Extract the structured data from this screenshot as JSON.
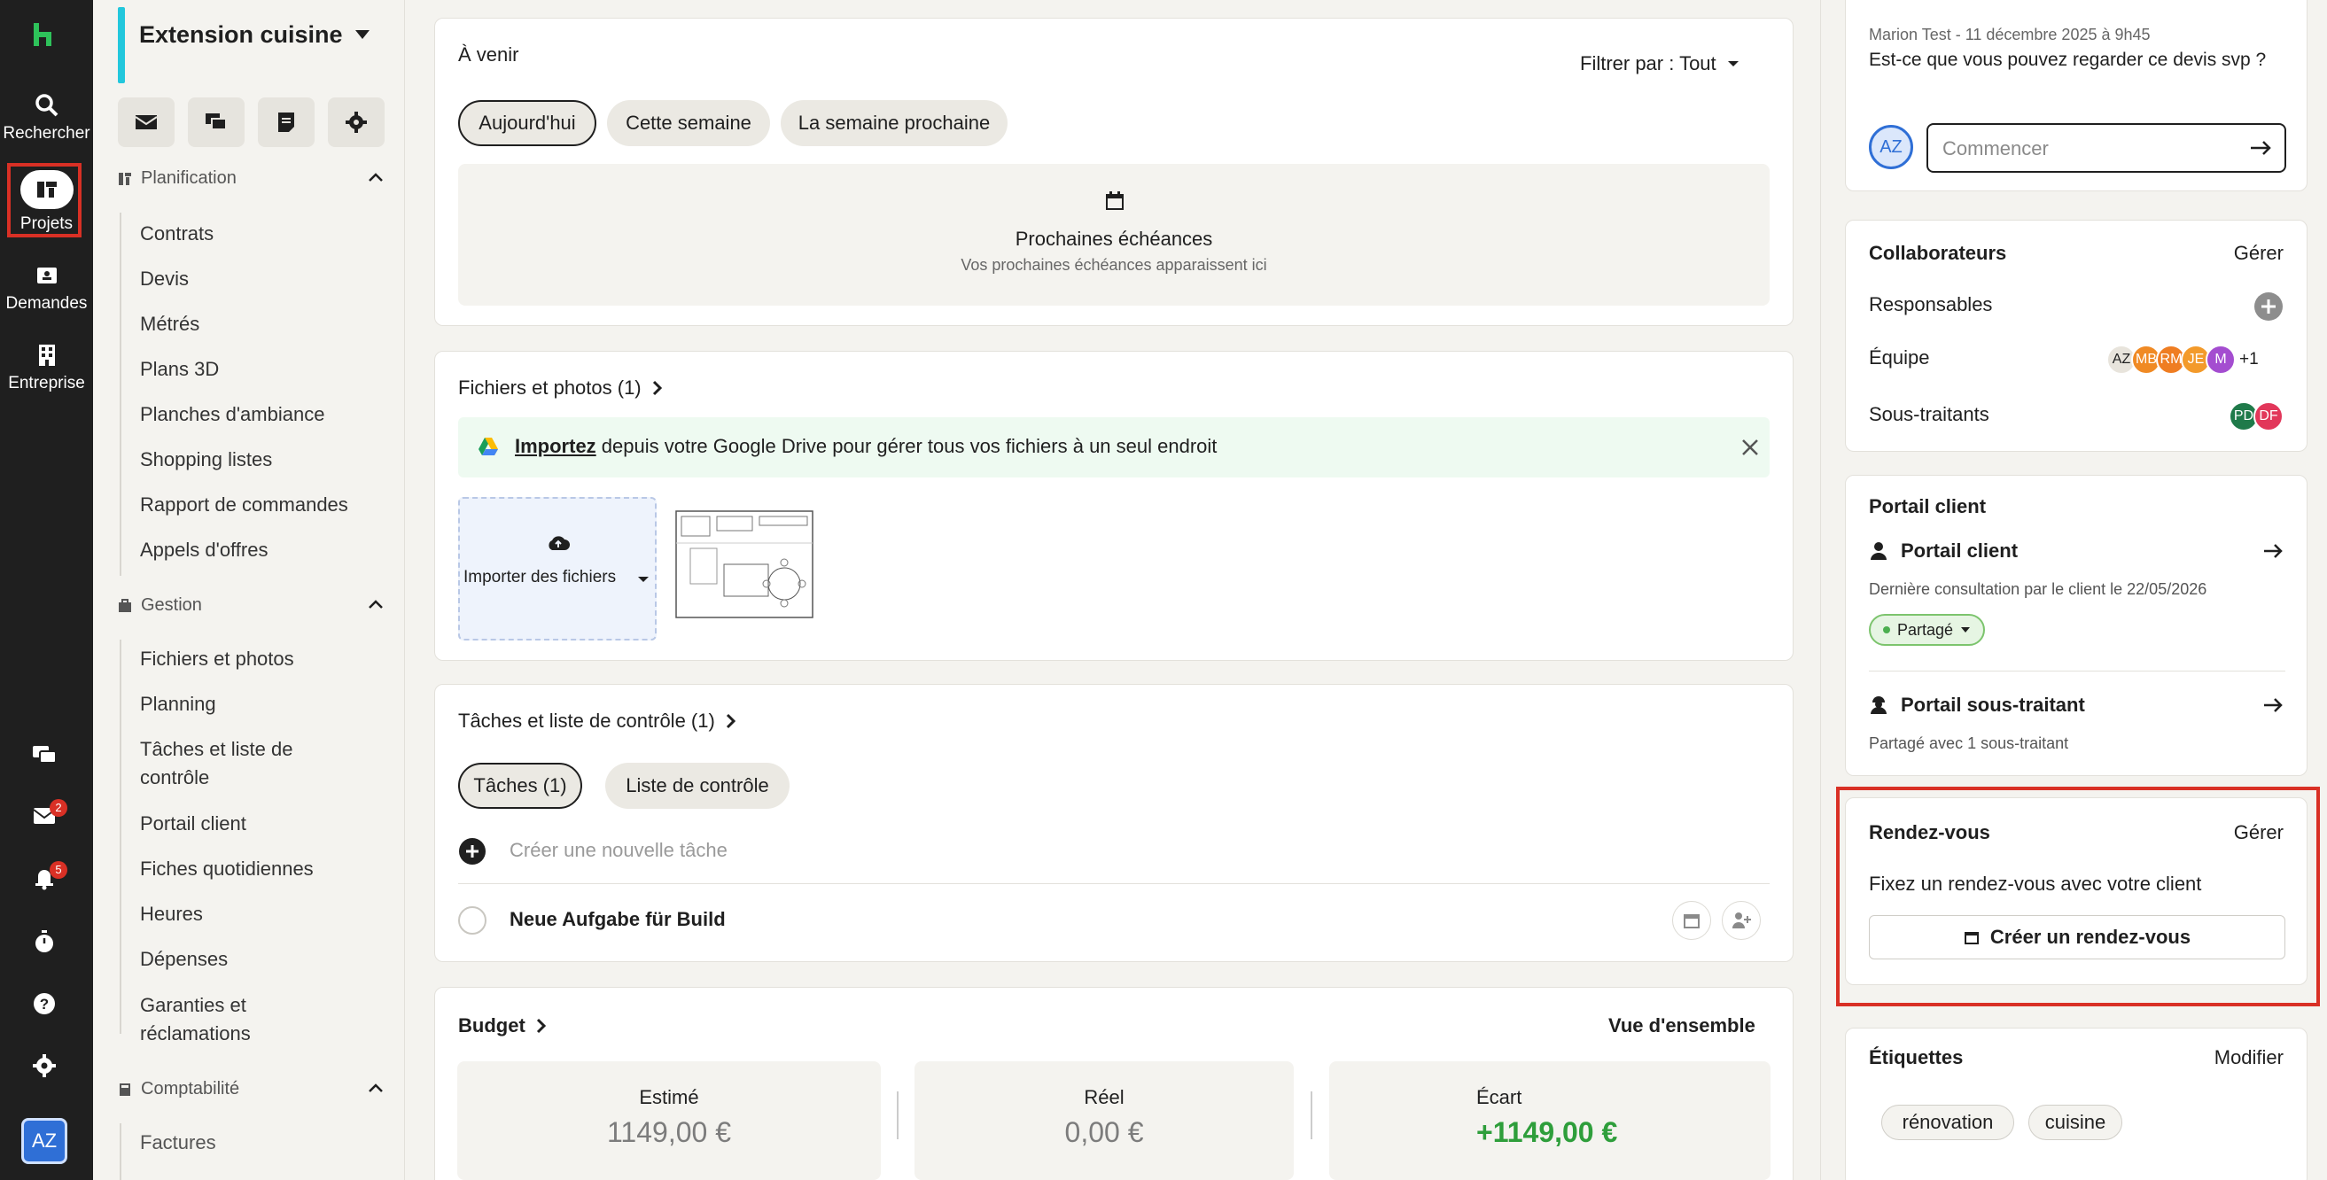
{
  "rail": {
    "items": [
      {
        "label": "Rechercher",
        "icon": "search-icon"
      },
      {
        "label": "Projets",
        "icon": "projects-icon"
      },
      {
        "label": "Demandes",
        "icon": "requests-icon"
      },
      {
        "label": "Entreprise",
        "icon": "building-icon"
      }
    ],
    "badges": {
      "inbox": "2",
      "notifications": "5"
    },
    "avatar": "AZ"
  },
  "project": {
    "name": "Extension cuisine",
    "sections": [
      {
        "title": "Planification",
        "items": [
          "Contrats",
          "Devis",
          "Métrés",
          "Plans 3D",
          "Planches d'ambiance",
          "Shopping listes",
          "Rapport de commandes",
          "Appels d'offres"
        ]
      },
      {
        "title": "Gestion",
        "items": [
          "Fichiers et photos",
          "Planning",
          "Tâches et liste de contrôle",
          "Portail client",
          "Fiches quotidiennes",
          "Heures",
          "Dépenses",
          "Garanties et réclamations"
        ]
      },
      {
        "title": "Comptabilité",
        "items": [
          "Factures"
        ]
      }
    ]
  },
  "upcoming": {
    "title": "À venir",
    "filter": "Filtrer par : Tout",
    "pills": [
      "Aujourd'hui",
      "Cette semaine",
      "La semaine prochaine"
    ],
    "empty_title": "Prochaines échéances",
    "empty_sub": "Vos prochaines échéances apparaissent ici"
  },
  "files": {
    "title": "Fichiers et photos (1)",
    "banner_link": "Importez",
    "banner_text": " depuis votre Google Drive pour gérer tous vos fichiers à un seul endroit",
    "upload_label": "Importer des fichiers"
  },
  "tasks": {
    "title": "Tâches et liste de contrôle (1)",
    "pills": [
      "Tâches (1)",
      "Liste de contrôle"
    ],
    "new_placeholder": "Créer une nouvelle tâche",
    "items": [
      "Neue Aufgabe für Build"
    ]
  },
  "budget": {
    "title": "Budget",
    "overview": "Vue d'ensemble",
    "boxes": [
      {
        "label": "Estimé",
        "value": "1149,00 €"
      },
      {
        "label": "Réel",
        "value": "0,00 €"
      },
      {
        "label": "Écart",
        "value": "+1149,00 €",
        "color": "#2e9e3b"
      }
    ]
  },
  "comment": {
    "meta": "Marion Test - 11 décembre 2025 à 9h45",
    "text": "Est-ce que vous pouvez regarder ce devis svp ?",
    "avatar": "AZ",
    "placeholder": "Commencer"
  },
  "collaborators": {
    "title": "Collaborateurs",
    "manage": "Gérer",
    "rows": [
      "Responsables",
      "Équipe",
      "Sous-traitants"
    ],
    "team": [
      {
        "initials": "AZ",
        "color": "#e8e4dc"
      },
      {
        "initials": "MB",
        "color": "#f08a24"
      },
      {
        "initials": "RM",
        "color": "#ef7d22"
      },
      {
        "initials": "JE",
        "color": "#f39a2a"
      },
      {
        "initials": "M",
        "color": "#a44dd0"
      }
    ],
    "team_more": "+1",
    "subs": [
      {
        "initials": "PD",
        "color": "#1f7a4a"
      },
      {
        "initials": "DF",
        "color": "#e2375a"
      }
    ]
  },
  "client_portal": {
    "title": "Portail client",
    "client_link": "Portail client",
    "last_seen": "Dernière consultation par le client le 22/05/2026",
    "status": "Partagé",
    "sub_link": "Portail sous-traitant",
    "sub_text": "Partagé avec 1 sous-traitant"
  },
  "appointments": {
    "title": "Rendez-vous",
    "manage": "Gérer",
    "text": "Fixez un rendez-vous avec votre client",
    "button": "Créer un rendez-vous"
  },
  "labels": {
    "title": "Étiquettes",
    "modify": "Modifier",
    "tags": [
      "rénovation",
      "cuisine"
    ]
  },
  "colors": {
    "accent_cyan": "#22c7dc",
    "highlight_red": "#d93025",
    "brand_green": "#2e9e3b"
  }
}
